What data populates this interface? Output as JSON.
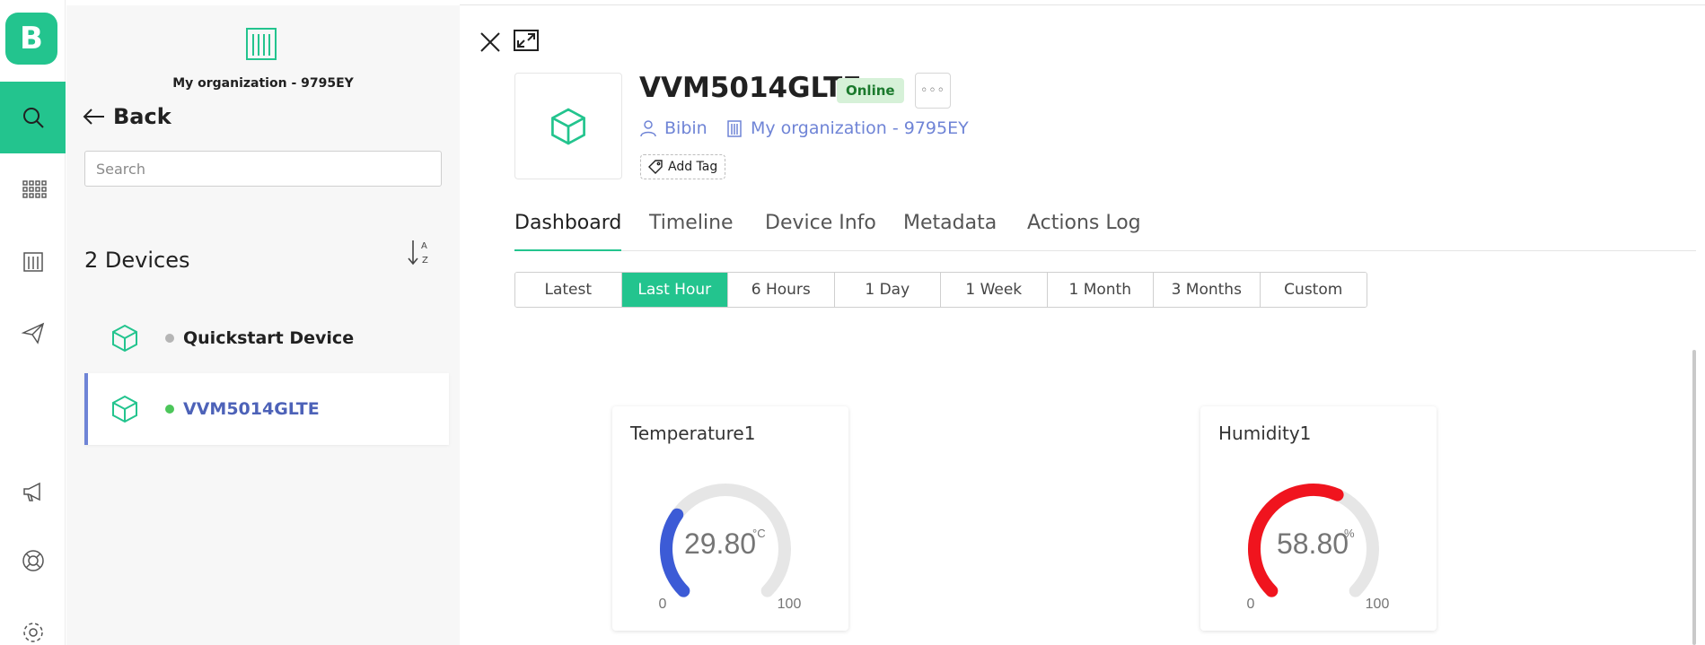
{
  "rail": {
    "logo_letter": "B",
    "brand_color": "#23c48e",
    "icons": [
      "search-icon",
      "apps-grid-icon",
      "building-icon",
      "send-icon",
      "megaphone-icon",
      "help-lifebuoy-icon",
      "settings-gear-icon"
    ],
    "active_icon": "search-icon"
  },
  "panel": {
    "org_name": "My organization - 9795EY",
    "back_label": "Back",
    "search_placeholder": "Search",
    "device_count": "2 Devices",
    "devices": [
      {
        "name": "Quickstart Device",
        "status_color": "#b5b5b5",
        "selected": false
      },
      {
        "name": "VVM5014GLTE",
        "status_color": "#4cc65a",
        "selected": true
      }
    ]
  },
  "device": {
    "title": "VVM5014GLTE",
    "status": "Online",
    "more_label": "◦◦◦",
    "owner": "Bibin",
    "organization": "My organization - 9795EY",
    "add_tag_label": "Add Tag"
  },
  "tabs": [
    "Dashboard",
    "Timeline",
    "Device Info",
    "Metadata",
    "Actions Log"
  ],
  "active_tab": "Dashboard",
  "time_ranges": [
    "Latest",
    "Last Hour",
    "6 Hours",
    "1 Day",
    "1 Week",
    "1 Month",
    "3 Months",
    "Custom"
  ],
  "active_range": "Last Hour",
  "widgets": [
    {
      "title": "Temperature1",
      "value": "29.80",
      "unit": "°C",
      "min": "0",
      "max": "100",
      "fraction": 0.298,
      "color": "#3c5bd6"
    },
    {
      "title": "Humidity1",
      "value": "58.80",
      "unit": "%",
      "min": "0",
      "max": "100",
      "fraction": 0.588,
      "color": "#f0141e"
    }
  ]
}
